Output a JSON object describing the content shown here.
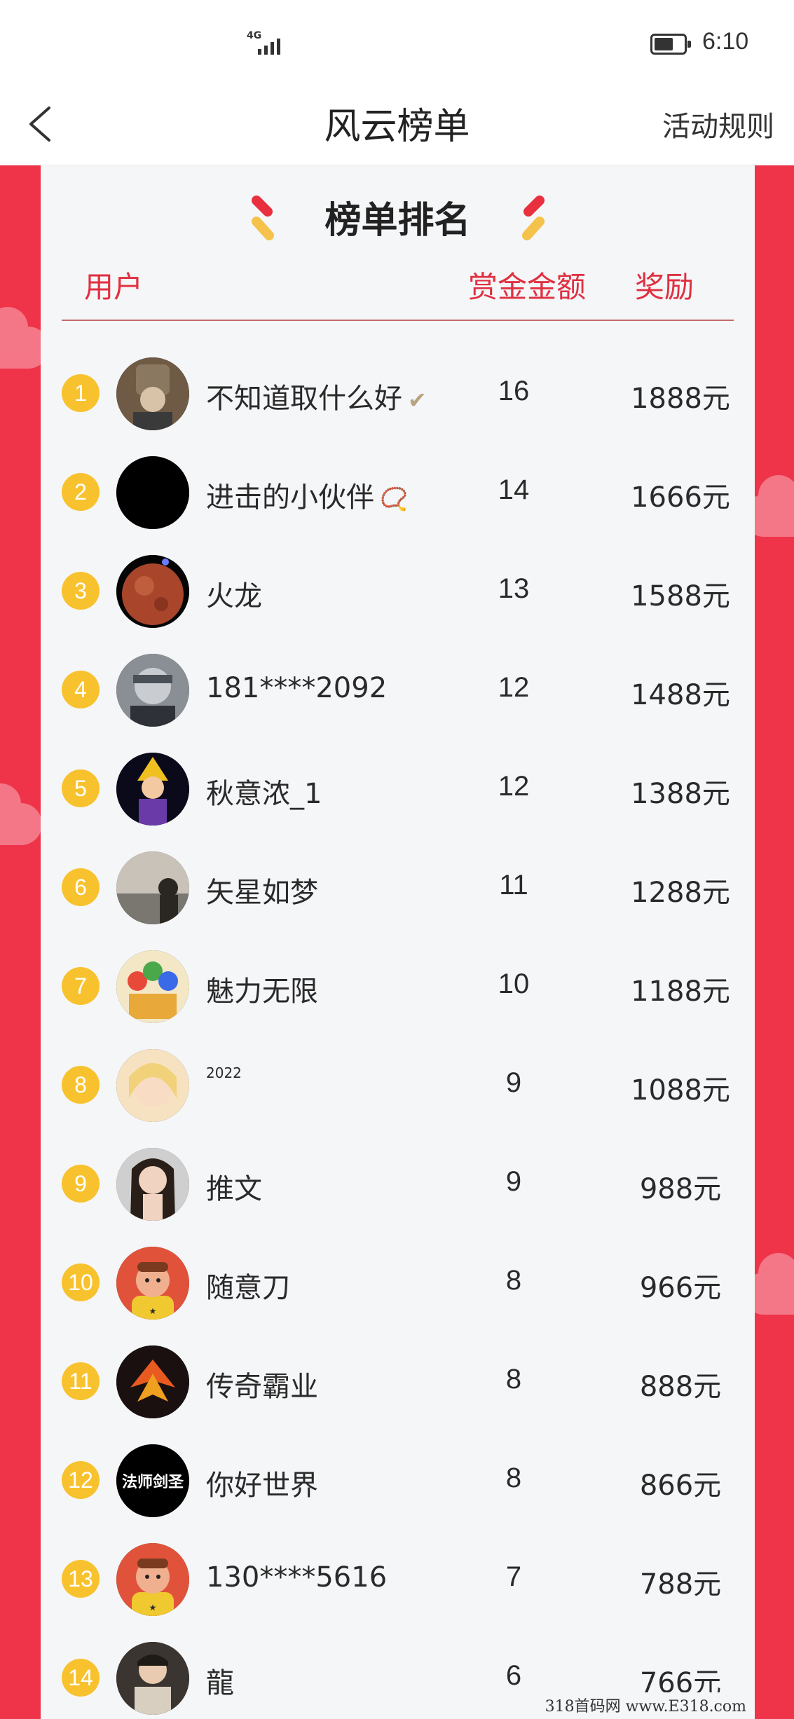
{
  "status_bar": {
    "network": "4G",
    "time": "6:10",
    "battery_level": 0.65
  },
  "nav": {
    "title": "风云榜单",
    "rules_label": "活动规则",
    "back_icon": "chevron-left-icon"
  },
  "card": {
    "title": "榜单排名",
    "headers": {
      "user": "用户",
      "amount": "赏金金额",
      "reward": "奖励"
    }
  },
  "ranking": [
    {
      "rank": "1",
      "name": "不知道取什么好",
      "badge": "✔",
      "amount": "16",
      "reward": "1888元",
      "avatar": "hooded-person"
    },
    {
      "rank": "2",
      "name": "进击的小伙伴",
      "badge": "📿",
      "amount": "14",
      "reward": "1666元",
      "avatar": "black"
    },
    {
      "rank": "3",
      "name": "火龙",
      "badge": "",
      "amount": "13",
      "reward": "1588元",
      "avatar": "mars-planet"
    },
    {
      "rank": "4",
      "name": "181****2092",
      "badge": "",
      "amount": "12",
      "reward": "1488元",
      "avatar": "masked-anime"
    },
    {
      "rank": "5",
      "name": "秋意浓_1",
      "badge": "",
      "amount": "12",
      "reward": "1388元",
      "avatar": "anime-warrior"
    },
    {
      "rank": "6",
      "name": "矢星如梦",
      "badge": "",
      "amount": "11",
      "reward": "1288元",
      "avatar": "seaside-silhouette"
    },
    {
      "rank": "7",
      "name": "魅力无限",
      "badge": "",
      "amount": "10",
      "reward": "1188元",
      "avatar": "colorful-deities"
    },
    {
      "rank": "8",
      "name": "2022",
      "badge": "",
      "amount": "9",
      "reward": "1088元",
      "avatar": "anime-girl"
    },
    {
      "rank": "9",
      "name": "推文",
      "badge": "",
      "amount": "9",
      "reward": "988元",
      "avatar": "woman-portrait"
    },
    {
      "rank": "10",
      "name": "随意刀",
      "badge": "",
      "amount": "8",
      "reward": "966元",
      "avatar": "default-cartoon"
    },
    {
      "rank": "11",
      "name": "传奇霸业",
      "badge": "",
      "amount": "8",
      "reward": "888元",
      "avatar": "fiery-wings"
    },
    {
      "rank": "12",
      "name": "你好世界",
      "badge": "",
      "amount": "8",
      "reward": "866元",
      "avatar": "text-logo",
      "avatar_text": "法师剑圣"
    },
    {
      "rank": "13",
      "name": "130****5616",
      "badge": "",
      "amount": "7",
      "reward": "788元",
      "avatar": "default-cartoon"
    },
    {
      "rank": "14",
      "name": "龍",
      "badge": "",
      "amount": "6",
      "reward": "766元",
      "avatar": "man-portrait"
    }
  ],
  "watermark": "318首码网 www.E318.com"
}
